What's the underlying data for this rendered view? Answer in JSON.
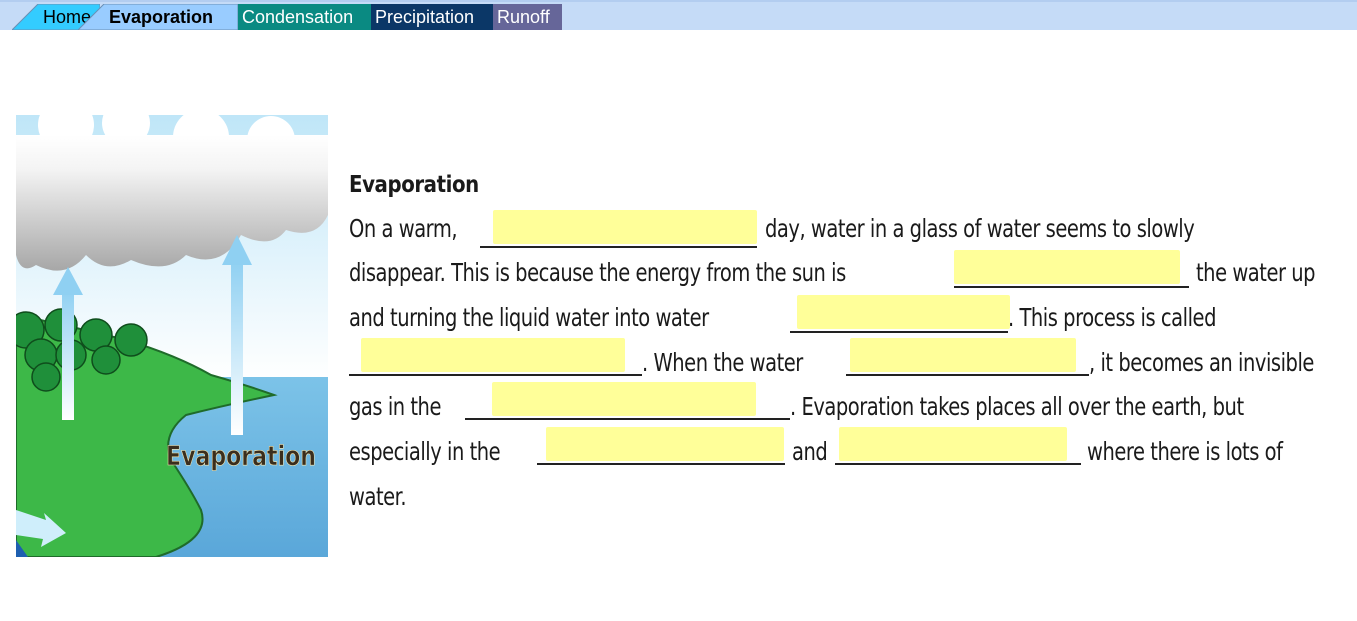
{
  "tabs": [
    {
      "label": "Home",
      "color": "#33ccff"
    },
    {
      "label": "Evaporation",
      "color": "#99ccff",
      "active": true
    },
    {
      "label": "Condensation",
      "color": "#0a8a82"
    },
    {
      "label": "Precipitation",
      "color": "#0b3767"
    },
    {
      "label": "Runoff",
      "color": "#666699"
    }
  ],
  "illustration": {
    "label": "Evaporation",
    "description": "Water cycle illustration: cloud, green land with trees, water, arrows rising"
  },
  "worksheet": {
    "title": "Evaporation",
    "blank_color": "#ffff99",
    "segments": {
      "s1": "On a warm,",
      "s2": "day, water in a glass of water seems to slowly",
      "s3": "disappear. This is because the energy from the sun is",
      "s4": "the water up",
      "s5": "and turning the liquid water into water",
      "s6": ". This process is called",
      "s7": ". When the water",
      "s8": ", it becomes an invisible",
      "s9": "gas in the",
      "s10": ". Evaporation takes places all over the earth, but",
      "s11": "especially in the",
      "s12": "and",
      "s13": "where there is lots of",
      "s14": "water."
    },
    "blanks": [
      {
        "value": ""
      },
      {
        "value": ""
      },
      {
        "value": ""
      },
      {
        "value": ""
      },
      {
        "value": ""
      },
      {
        "value": ""
      },
      {
        "value": ""
      },
      {
        "value": ""
      }
    ]
  }
}
